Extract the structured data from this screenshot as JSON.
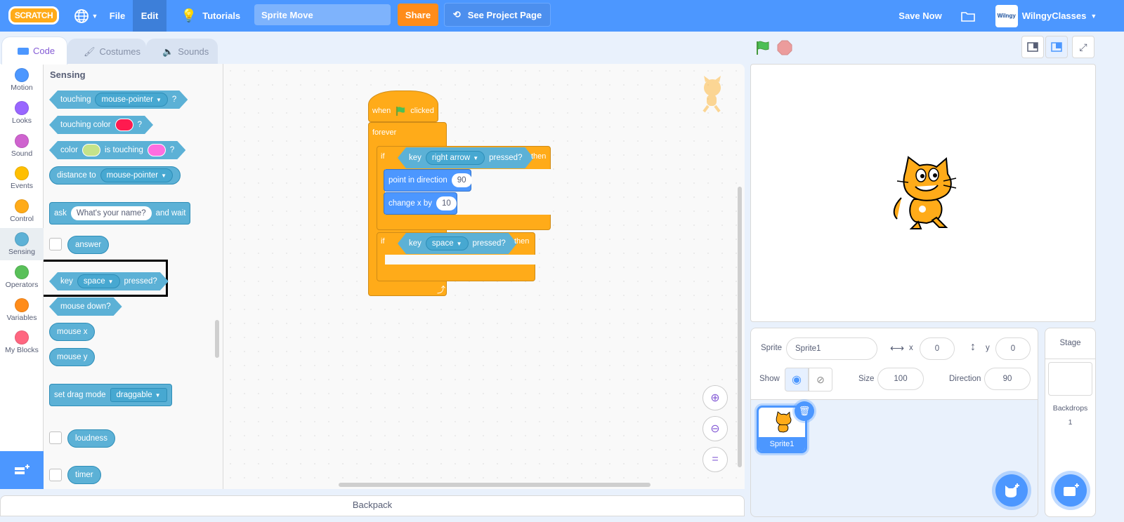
{
  "header": {
    "logo": "SCRATCH",
    "menu": [
      "File",
      "Edit"
    ],
    "tutorials": "Tutorials",
    "project_title": "Sprite Move",
    "share": "Share",
    "see_project": "See Project Page",
    "save_now": "Save Now",
    "username": "WilngyClasses",
    "avatar_text": "Wilngy"
  },
  "tabs": [
    {
      "label": "Code",
      "icon": "code-icon"
    },
    {
      "label": "Costumes",
      "icon": "brush-icon"
    },
    {
      "label": "Sounds",
      "icon": "speaker-icon"
    }
  ],
  "categories": [
    {
      "label": "Motion",
      "color": "#4c97ff"
    },
    {
      "label": "Looks",
      "color": "#9966ff"
    },
    {
      "label": "Sound",
      "color": "#cf63cf"
    },
    {
      "label": "Events",
      "color": "#ffbf00"
    },
    {
      "label": "Control",
      "color": "#ffab19"
    },
    {
      "label": "Sensing",
      "color": "#5cb1d6"
    },
    {
      "label": "Operators",
      "color": "#59c059"
    },
    {
      "label": "Variables",
      "color": "#ff8c1a"
    },
    {
      "label": "My Blocks",
      "color": "#ff6680"
    }
  ],
  "palette": {
    "heading": "Sensing",
    "touching": {
      "label": "touching",
      "menu": "mouse-pointer",
      "q": "?"
    },
    "touching_color": {
      "label": "touching color",
      "q": "?",
      "swatch": "#ff1a4f"
    },
    "color_touching": {
      "label": "color",
      "mid": "is touching",
      "q": "?",
      "swatch1": "#c5e38a",
      "swatch2": "#ff6ee0"
    },
    "distance": {
      "label": "distance to",
      "menu": "mouse-pointer"
    },
    "ask": {
      "label": "ask",
      "value": "What's your name?",
      "tail": "and wait"
    },
    "answer": "answer",
    "key_pressed": {
      "label": "key",
      "menu": "space",
      "tail": "pressed?"
    },
    "mouse_down": "mouse down?",
    "mouse_x": "mouse x",
    "mouse_y": "mouse y",
    "drag": {
      "label": "set drag mode",
      "menu": "draggable"
    },
    "loudness": "loudness",
    "timer": "timer"
  },
  "script": {
    "hat": {
      "pre": "when",
      "post": "clicked"
    },
    "forever": "forever",
    "if1": {
      "if": "if",
      "key": "key",
      "menu": "right arrow",
      "pressed": "pressed?",
      "then": "then"
    },
    "point": {
      "label": "point in direction",
      "value": "90"
    },
    "change": {
      "label": "change x by",
      "value": "10"
    },
    "if2": {
      "if": "if",
      "key": "key",
      "menu": "space",
      "pressed": "pressed?",
      "then": "then"
    }
  },
  "sprite_info": {
    "sprite_label": "Sprite",
    "sprite_name": "Sprite1",
    "x_label": "x",
    "x": "0",
    "y_label": "y",
    "y": "0",
    "show_label": "Show",
    "size_label": "Size",
    "size": "100",
    "direction_label": "Direction",
    "direction": "90"
  },
  "sprites": [
    {
      "name": "Sprite1"
    }
  ],
  "stage_pane": {
    "title": "Stage",
    "backdrops_label": "Backdrops",
    "backdrops": "1"
  },
  "backpack": "Backpack"
}
